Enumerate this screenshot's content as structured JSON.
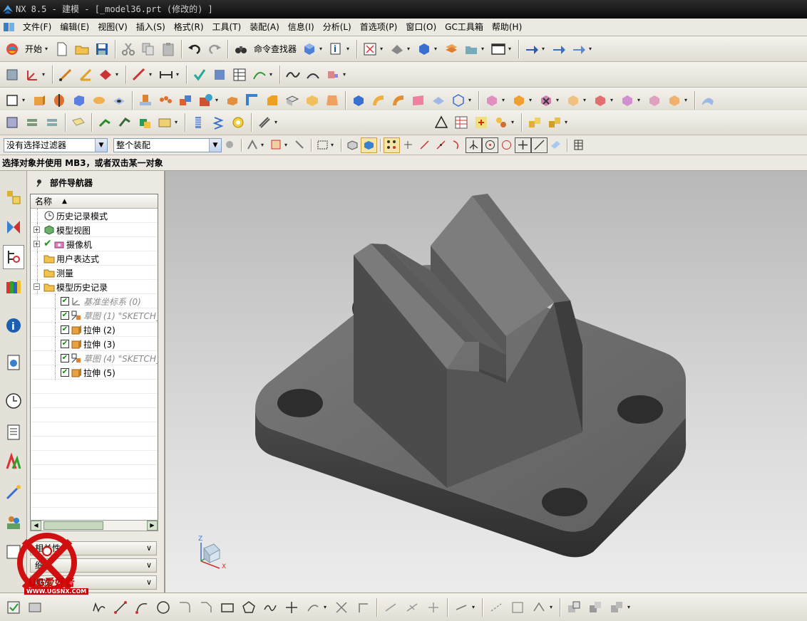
{
  "window": {
    "title": "NX 8.5 - 建模 - [_model36.prt  (修改的) ]"
  },
  "menu": [
    "文件(F)",
    "编辑(E)",
    "视图(V)",
    "插入(S)",
    "格式(R)",
    "工具(T)",
    "装配(A)",
    "信息(I)",
    "分析(L)",
    "首选项(P)",
    "窗口(O)",
    "GC工具箱",
    "帮助(H)"
  ],
  "toolbar": {
    "start_label": "开始",
    "command_finder_label": "命令查找器"
  },
  "selection_bar": {
    "filter_value": "没有选择过滤器",
    "scope_value": "整个装配"
  },
  "cue_line": "选择对象并使用 MB3，或者双击某一对象",
  "navigator": {
    "title": "部件导航器",
    "column_name": "名称",
    "items": [
      {
        "label": "历史记录模式",
        "level": 0,
        "icon": "clock-icon"
      },
      {
        "label": "模型视图",
        "level": 0,
        "icon": "model-views-icon",
        "expander": "+"
      },
      {
        "label": "摄像机",
        "level": 0,
        "icon": "camera-icon",
        "expander": "+",
        "checked": true
      },
      {
        "label": "用户表达式",
        "level": 0,
        "icon": "folder-icon"
      },
      {
        "label": "测量",
        "level": 0,
        "icon": "folder-icon"
      },
      {
        "label": "模型历史记录",
        "level": 0,
        "icon": "folder-icon",
        "expander": "−"
      },
      {
        "label": "基准坐标系 (0)",
        "level": 1,
        "icon": "datum-csys-icon",
        "checked": true,
        "dim": true
      },
      {
        "label": "草图 (1) \"SKETCH_",
        "level": 1,
        "icon": "sketch-icon",
        "checked": true,
        "dim": true
      },
      {
        "label": "拉伸 (2)",
        "level": 1,
        "icon": "extrude-icon",
        "checked": true
      },
      {
        "label": "拉伸 (3)",
        "level": 1,
        "icon": "extrude-icon",
        "checked": true
      },
      {
        "label": "草图 (4) \"SKETCH_",
        "level": 1,
        "icon": "sketch-icon",
        "checked": true,
        "dim": true
      },
      {
        "label": "拉伸 (5)",
        "level": 1,
        "icon": "extrude-icon",
        "checked": true
      }
    ],
    "sections": [
      "相关性",
      "细节",
      "预览"
    ]
  },
  "triad": {
    "z": "Z",
    "x": "X"
  },
  "watermark": {
    "text": "UG爱好者",
    "url": "WWW.UGSNX.COM"
  },
  "colors": {
    "viewport_top": "#b8b8b8",
    "viewport_bottom": "#ececec",
    "model_top": "#6b6b6b",
    "model_side": "#3a3a3a",
    "title_bg": "#1a1a1a"
  }
}
